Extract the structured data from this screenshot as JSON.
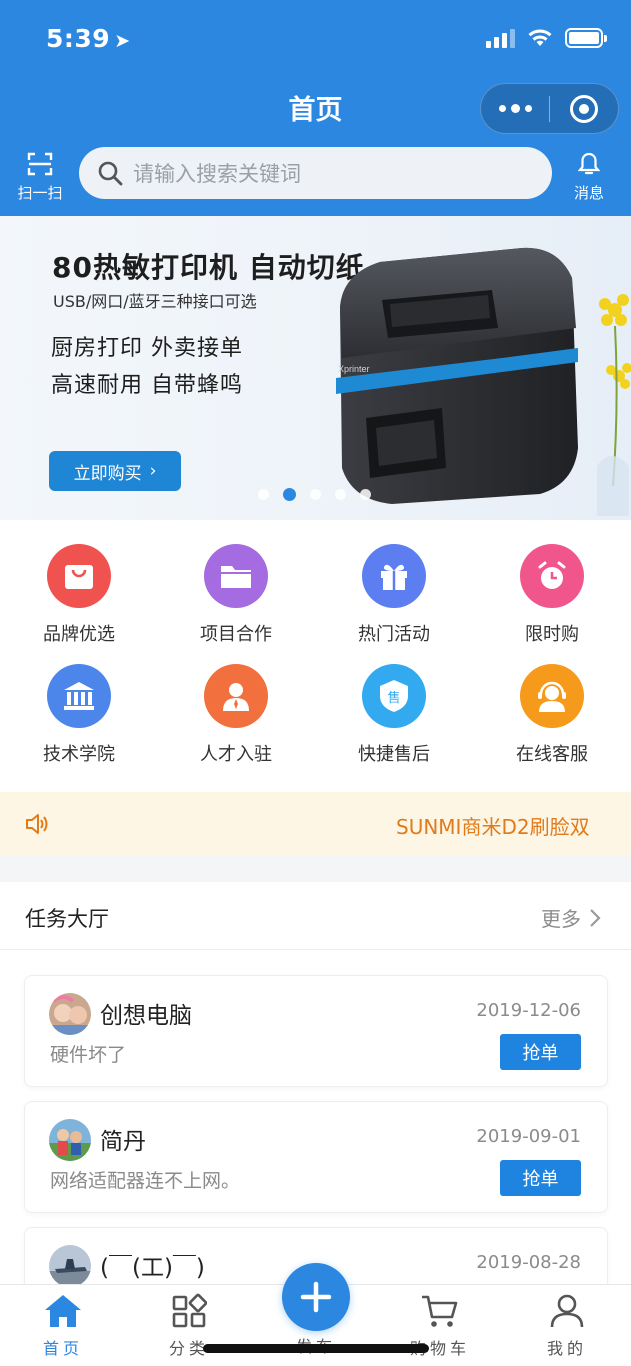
{
  "status_bar": {
    "time": "5:39"
  },
  "header": {
    "title": "首页",
    "scan_label": "扫一扫",
    "search_placeholder": "请输入搜索关键词",
    "message_label": "消息"
  },
  "banner": {
    "title": "80热敏打印机  自动切纸",
    "subtitle": "USB/网口/蓝牙三种接口可选",
    "line1": "厨房打印   外卖接单",
    "line2": "高速耐用   自带蜂鸣",
    "button_label": "立即购买",
    "printer_brand": "Xprinter",
    "slides_total": 5,
    "active_slide": 2
  },
  "categories": [
    {
      "label": "品牌优选",
      "icon": "shopping-bag-icon",
      "color": "#f0524f"
    },
    {
      "label": "项目合作",
      "icon": "folder-icon",
      "color": "#a56be0"
    },
    {
      "label": "热门活动",
      "icon": "gift-icon",
      "color": "#5c7ef0"
    },
    {
      "label": "限时购",
      "icon": "alarm-clock-icon",
      "color": "#f0568c"
    },
    {
      "label": "技术学院",
      "icon": "institution-icon",
      "color": "#4d86ea"
    },
    {
      "label": "人才入驻",
      "icon": "person-icon",
      "color": "#f26f3e"
    },
    {
      "label": "快捷售后",
      "icon": "after-sales-icon",
      "color": "#33a9ef",
      "badge": "售"
    },
    {
      "label": "在线客服",
      "icon": "headset-icon",
      "color": "#f59a1a"
    }
  ],
  "notice": {
    "text": "SUNMI商米D2刷脸双"
  },
  "task_hall": {
    "title": "任务大厅",
    "more_label": "更多",
    "action_label": "抢单",
    "tasks": [
      {
        "name": "创想电脑",
        "date": "2019-12-06",
        "desc": "硬件坏了"
      },
      {
        "name": "简丹",
        "date": "2019-09-01",
        "desc": "网络适配器连不上网。"
      },
      {
        "name": "(￣(工)￣)",
        "date": "2019-08-28",
        "desc": ""
      }
    ]
  },
  "tabbar": {
    "home": "首页",
    "category": "分类",
    "publish": "发布",
    "cart": "购物车",
    "mine": "我的"
  },
  "colors": {
    "primary": "#2c87e0",
    "notice_text": "#e07b1c",
    "notice_bg": "#fdf6e4"
  }
}
